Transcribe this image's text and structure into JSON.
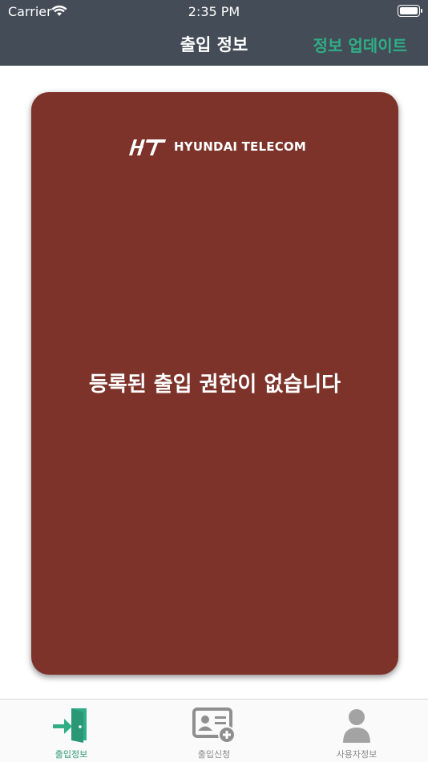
{
  "status_bar": {
    "carrier": "Carrier",
    "time": "2:35 PM"
  },
  "nav": {
    "title": "출입 정보",
    "update_label": "정보 업데이트"
  },
  "card": {
    "logo_text": "HYUNDAI TELECOM",
    "message": "등록된 출입 권한이 없습니다",
    "background_color": "#7d332a"
  },
  "tabbar": {
    "items": [
      {
        "label": "출입정보",
        "icon": "door-enter-icon",
        "active": true
      },
      {
        "label": "출입신청",
        "icon": "id-card-add-icon",
        "active": false
      },
      {
        "label": "사용자정보",
        "icon": "user-icon",
        "active": false
      }
    ]
  },
  "colors": {
    "nav_bg": "#434c57",
    "accent": "#2fae86"
  }
}
